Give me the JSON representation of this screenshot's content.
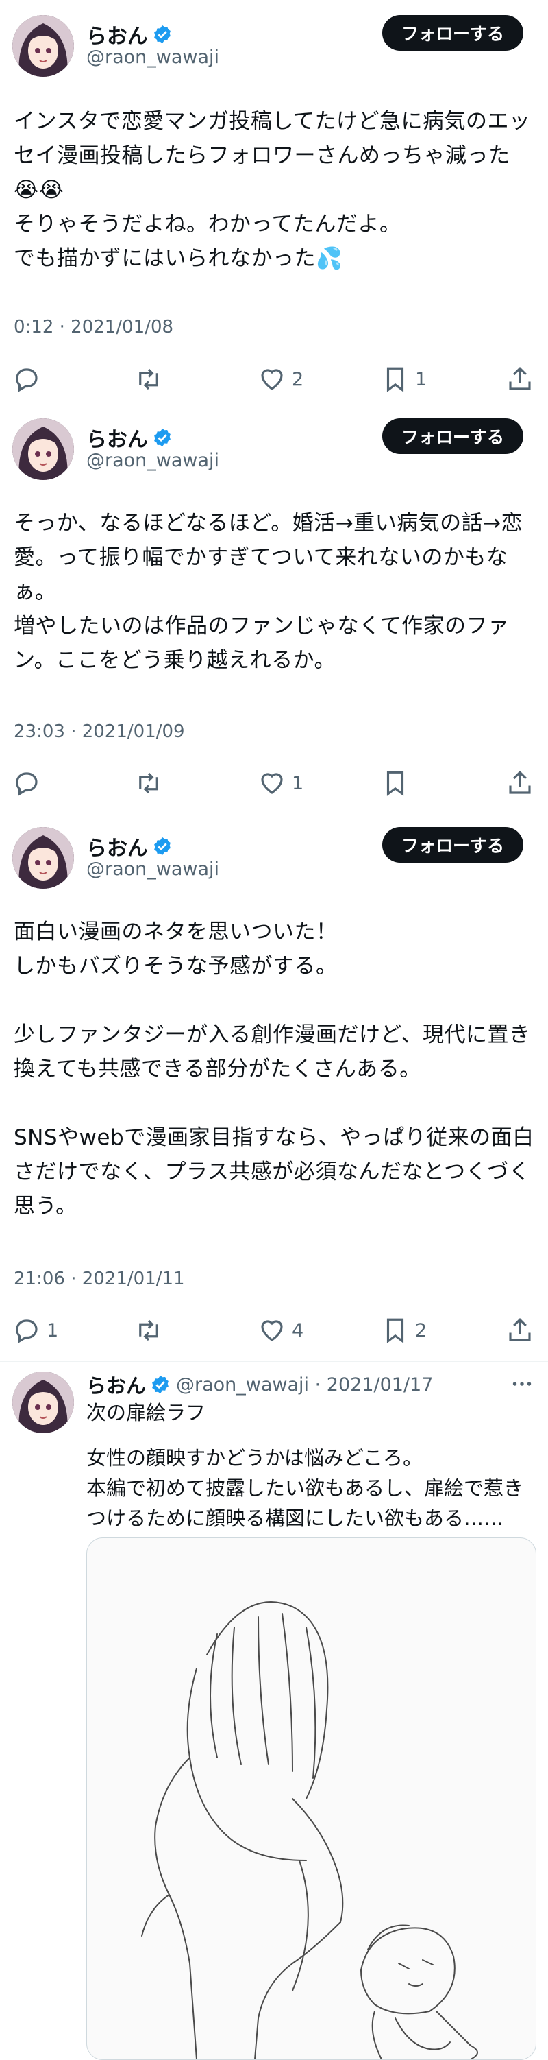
{
  "user": {
    "name": "らおん",
    "handle": "@raon_wawaji"
  },
  "follow_label": "フォローする",
  "tweets": [
    {
      "text": "インスタで恋愛マンガ投稿してたけど急に病気のエッセイ漫画投稿したらフォロワーさんめっちゃ減った😭😭\nそりゃそうだよね。わかってたんだよ。\nでも描かずにはいられなかった💦",
      "timestamp": "0:12 · 2021/01/08",
      "replies": "",
      "likes": "2",
      "bookmarks": "1"
    },
    {
      "text": "そっか、なるほどなるほど。婚活→重い病気の話→恋愛。って振り幅でかすぎてついて来れないのかもなぁ。\n増やしたいのは作品のファンじゃなくて作家のファン。ここをどう乗り越えれるか。",
      "timestamp": "23:03 · 2021/01/09",
      "replies": "",
      "likes": "1",
      "bookmarks": ""
    },
    {
      "text": "面白い漫画のネタを思いついた！\nしかもバズりそうな予感がする。\n\n少しファンタジーが入る創作漫画だけど、現代に置き換えても共感できる部分がたくさんある。\n\nSNSやwebで漫画家目指すなら、やっぱり従来の面白さだけでなく、プラス共感が必須なんだなとつくづく思う。",
      "timestamp": "21:06 · 2021/01/11",
      "replies": "1",
      "likes": "4",
      "bookmarks": "2"
    }
  ],
  "reply_tweet": {
    "meta": "@raon_wawaji · 2021/01/17",
    "title": "次の扉絵ラフ",
    "text": "女性の顔映すかどうかは悩みどころ。\n本編で初めて披露したい欲もあるし、扉絵で惹きつけるために顔映る構図にしたい欲もある……"
  },
  "icons": {
    "verified": "verified-badge-icon",
    "reply": "reply-icon",
    "retweet": "retweet-icon",
    "like": "heart-icon",
    "bookmark": "bookmark-icon",
    "share": "share-icon",
    "more": "more-icon"
  },
  "colors": {
    "verified": "#1d9bf0",
    "muted": "#536471",
    "button": "#0f1419"
  }
}
